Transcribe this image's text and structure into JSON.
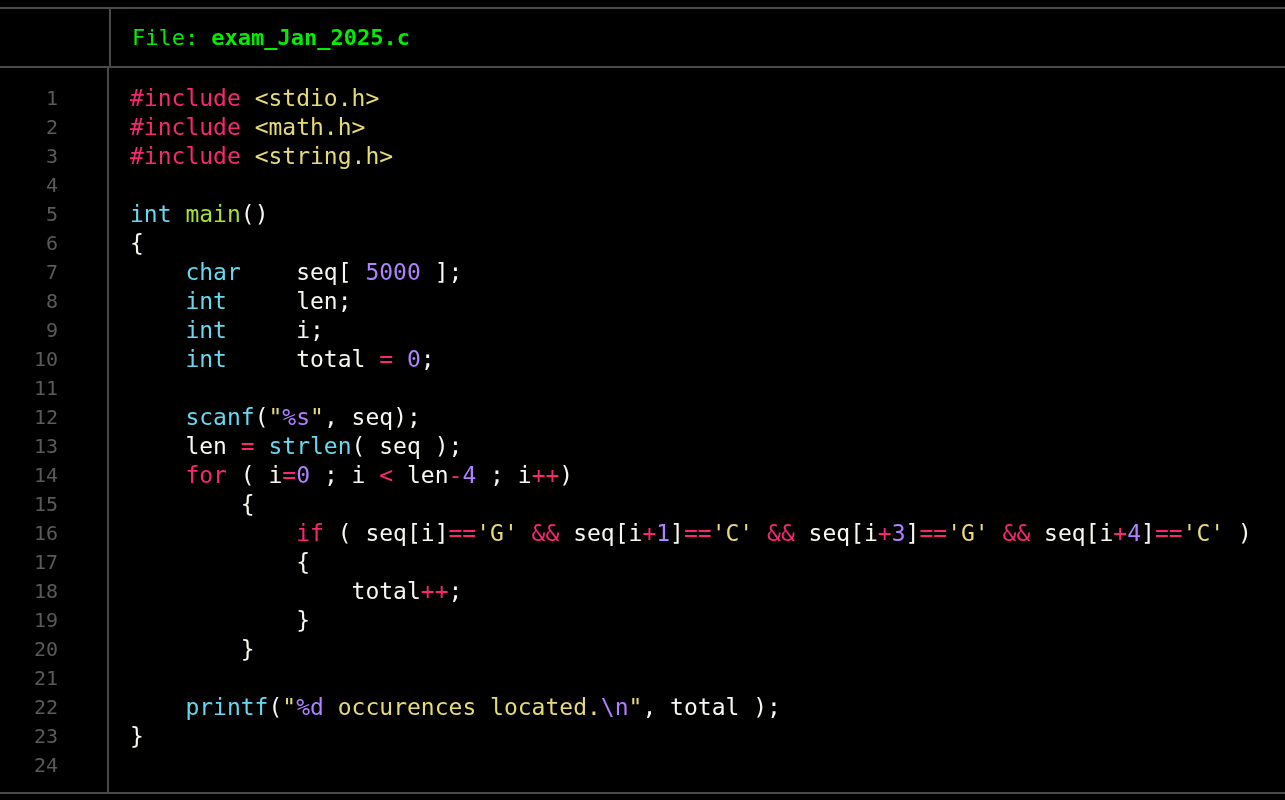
{
  "header": {
    "label": "File:",
    "filename": "exam_Jan_2025.c"
  },
  "lines": [
    {
      "number": "1",
      "tokens": [
        {
          "kind": "keyword",
          "text": "#include "
        },
        {
          "kind": "string",
          "text": "<stdio.h>"
        }
      ]
    },
    {
      "number": "2",
      "tokens": [
        {
          "kind": "keyword",
          "text": "#include "
        },
        {
          "kind": "string",
          "text": "<math.h>"
        }
      ]
    },
    {
      "number": "3",
      "tokens": [
        {
          "kind": "keyword",
          "text": "#include "
        },
        {
          "kind": "string",
          "text": "<string.h>"
        }
      ]
    },
    {
      "number": "4"
    },
    {
      "number": "5",
      "tokens": [
        {
          "kind": "type",
          "text": "int "
        },
        {
          "kind": "function",
          "text": "main"
        },
        {
          "kind": "plain",
          "text": "()"
        }
      ]
    },
    {
      "number": "6",
      "tokens": [
        {
          "kind": "plain",
          "text": "{"
        }
      ]
    },
    {
      "number": "7",
      "tokens": [
        {
          "kind": "type",
          "text": "    char"
        },
        {
          "kind": "plain",
          "text": "    seq[ "
        },
        {
          "kind": "number",
          "text": "5000"
        },
        {
          "kind": "plain",
          "text": " ];"
        }
      ]
    },
    {
      "number": "8",
      "tokens": [
        {
          "kind": "type",
          "text": "    int"
        },
        {
          "kind": "plain",
          "text": "     len;"
        }
      ]
    },
    {
      "number": "9",
      "tokens": [
        {
          "kind": "type",
          "text": "    int"
        },
        {
          "kind": "plain",
          "text": "     i;"
        }
      ]
    },
    {
      "number": "10",
      "tokens": [
        {
          "kind": "type",
          "text": "    int"
        },
        {
          "kind": "plain",
          "text": "     total "
        },
        {
          "kind": "operator",
          "text": "= "
        },
        {
          "kind": "number",
          "text": "0"
        },
        {
          "kind": "plain",
          "text": ";"
        }
      ]
    },
    {
      "number": "11"
    },
    {
      "number": "12",
      "tokens": [
        {
          "kind": "type",
          "text": "    scanf"
        },
        {
          "kind": "plain",
          "text": "("
        },
        {
          "kind": "string",
          "text": "\""
        },
        {
          "kind": "escape",
          "text": "%s"
        },
        {
          "kind": "string",
          "text": "\""
        },
        {
          "kind": "plain",
          "text": ", seq);"
        }
      ]
    },
    {
      "number": "13",
      "tokens": [
        {
          "kind": "plain",
          "text": "    len "
        },
        {
          "kind": "operator",
          "text": "= "
        },
        {
          "kind": "type",
          "text": "strlen"
        },
        {
          "kind": "plain",
          "text": "( seq );"
        }
      ]
    },
    {
      "number": "14",
      "tokens": [
        {
          "kind": "keyword",
          "text": "    for"
        },
        {
          "kind": "plain",
          "text": " ( i"
        },
        {
          "kind": "operator",
          "text": "="
        },
        {
          "kind": "number",
          "text": "0"
        },
        {
          "kind": "plain",
          "text": " ; i "
        },
        {
          "kind": "operator",
          "text": "<"
        },
        {
          "kind": "plain",
          "text": " len"
        },
        {
          "kind": "operator",
          "text": "-"
        },
        {
          "kind": "number",
          "text": "4"
        },
        {
          "kind": "plain",
          "text": " ; i"
        },
        {
          "kind": "operator",
          "text": "++"
        },
        {
          "kind": "plain",
          "text": ")"
        }
      ]
    },
    {
      "number": "15",
      "tokens": [
        {
          "kind": "plain",
          "text": "        {"
        }
      ]
    },
    {
      "number": "16",
      "tokens": [
        {
          "kind": "keyword",
          "text": "            if"
        },
        {
          "kind": "plain",
          "text": " ( seq[i]"
        },
        {
          "kind": "operator",
          "text": "=="
        },
        {
          "kind": "string",
          "text": "'G' "
        },
        {
          "kind": "operator",
          "text": "&&"
        },
        {
          "kind": "plain",
          "text": " seq[i"
        },
        {
          "kind": "operator",
          "text": "+"
        },
        {
          "kind": "number",
          "text": "1"
        },
        {
          "kind": "plain",
          "text": "]"
        },
        {
          "kind": "operator",
          "text": "=="
        },
        {
          "kind": "string",
          "text": "'C' "
        },
        {
          "kind": "operator",
          "text": "&&"
        },
        {
          "kind": "plain",
          "text": " seq[i"
        },
        {
          "kind": "operator",
          "text": "+"
        },
        {
          "kind": "number",
          "text": "3"
        },
        {
          "kind": "plain",
          "text": "]"
        },
        {
          "kind": "operator",
          "text": "=="
        },
        {
          "kind": "string",
          "text": "'G' "
        },
        {
          "kind": "operator",
          "text": "&&"
        },
        {
          "kind": "plain",
          "text": " seq[i"
        },
        {
          "kind": "operator",
          "text": "+"
        },
        {
          "kind": "number",
          "text": "4"
        },
        {
          "kind": "plain",
          "text": "]"
        },
        {
          "kind": "operator",
          "text": "=="
        },
        {
          "kind": "string",
          "text": "'C'"
        },
        {
          "kind": "plain",
          "text": " )"
        }
      ]
    },
    {
      "number": "17",
      "tokens": [
        {
          "kind": "plain",
          "text": "            {"
        }
      ]
    },
    {
      "number": "18",
      "tokens": [
        {
          "kind": "plain",
          "text": "                total"
        },
        {
          "kind": "operator",
          "text": "++"
        },
        {
          "kind": "plain",
          "text": ";"
        }
      ]
    },
    {
      "number": "19",
      "tokens": [
        {
          "kind": "plain",
          "text": "            }"
        }
      ]
    },
    {
      "number": "20",
      "tokens": [
        {
          "kind": "plain",
          "text": "        }"
        }
      ]
    },
    {
      "number": "21"
    },
    {
      "number": "22",
      "tokens": [
        {
          "kind": "type",
          "text": "    printf"
        },
        {
          "kind": "plain",
          "text": "("
        },
        {
          "kind": "string",
          "text": "\""
        },
        {
          "kind": "escape",
          "text": "%d"
        },
        {
          "kind": "string",
          "text": " occurences located."
        },
        {
          "kind": "escape",
          "text": "\\n"
        },
        {
          "kind": "string",
          "text": "\""
        },
        {
          "kind": "plain",
          "text": ", total );"
        }
      ]
    },
    {
      "number": "23",
      "tokens": [
        {
          "kind": "plain",
          "text": "}"
        }
      ]
    },
    {
      "number": "24"
    }
  ]
}
